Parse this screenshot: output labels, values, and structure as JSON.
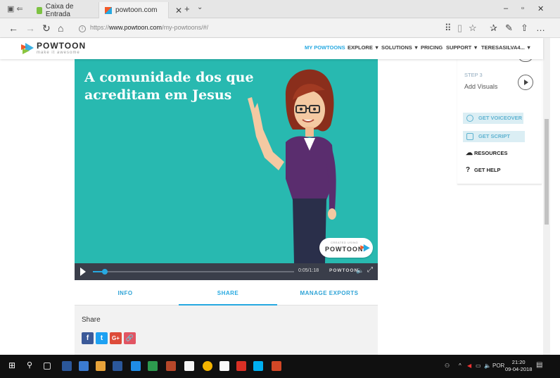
{
  "browser": {
    "tabs": [
      {
        "label": "Caixa de Entrada"
      },
      {
        "label": "powtoon.com"
      }
    ],
    "url_prefix": "https://",
    "url_host": "www.powtoon.com",
    "url_path": "/my-powtoons/#/"
  },
  "header": {
    "logo_word": "POWTOON",
    "logo_tagline": "make it awesome",
    "nav": [
      "MY POWTOONS",
      "EXPLORE ▼",
      "SOLUTIONS ▼",
      "PRICING",
      "SUPPORT ▼",
      "TERESASILVA4... ▼"
    ]
  },
  "video": {
    "title_line1": "A comunidade dos que",
    "title_line2": "acreditam em Jesus",
    "watermark_small": "CREATED USING",
    "watermark_brand": "POWTOON",
    "time": "0:05/1:18",
    "brand": "POWTOON",
    "progress": 0.06
  },
  "panel_tabs": [
    "INFO",
    "SHARE",
    "MANAGE EXPORTS"
  ],
  "share": {
    "label": "Share",
    "buttons": [
      "f",
      "t",
      "G+",
      "🔗"
    ]
  },
  "right_panel": {
    "step": "STEP 3",
    "step_name": "Add Visuals",
    "voiceover": "GET VOICEOVER",
    "script": "GET SCRIPT",
    "resources": "RESOURCES",
    "help": "GET HELP"
  },
  "taskbar": {
    "lang": "POR",
    "time": "21:20",
    "date": "09-04-2018"
  },
  "colors": {
    "video_bg": "#28b9b0",
    "accent": "#27a9e1",
    "facebook": "#3b5998",
    "twitter": "#1da1f2",
    "googleplus": "#dd4b39",
    "link": "#e25563"
  }
}
